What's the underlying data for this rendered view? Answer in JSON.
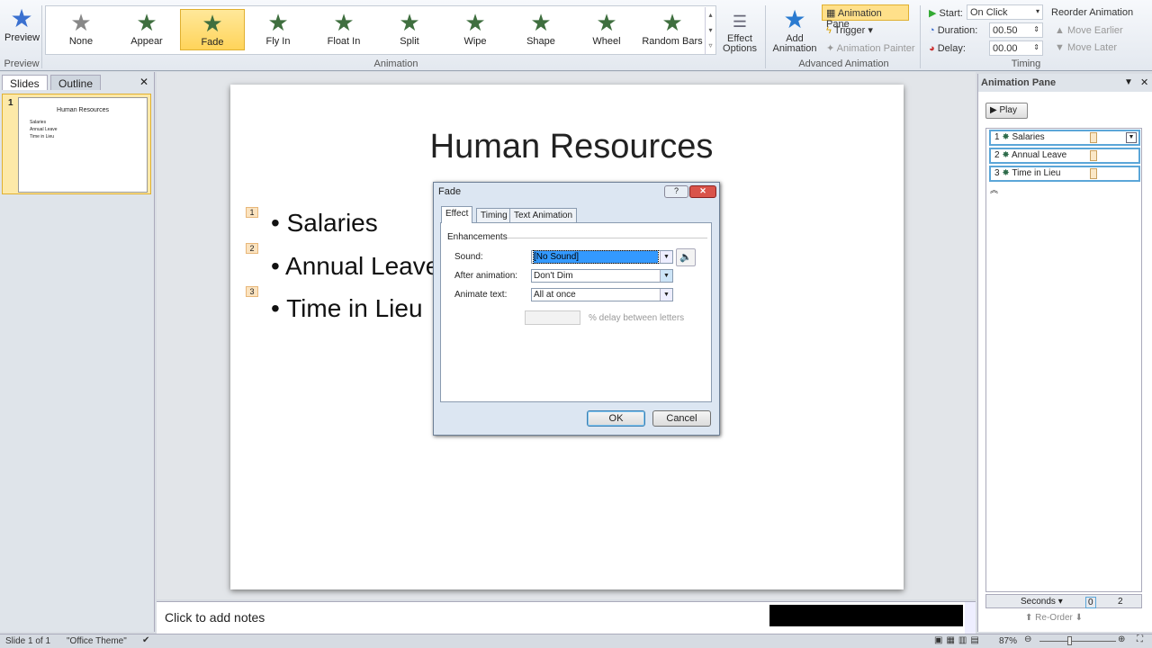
{
  "ribbon": {
    "preview": {
      "label": "Preview",
      "group": "Preview"
    },
    "animation_group": "Animation",
    "effects": [
      "None",
      "Appear",
      "Fade",
      "Fly In",
      "Float In",
      "Split",
      "Wipe",
      "Shape",
      "Wheel",
      "Random Bars"
    ],
    "selected_effect": "Fade",
    "effect_options": "Effect Options",
    "add_animation": "Add Animation",
    "animation_pane": "Animation Pane",
    "trigger": "Trigger",
    "animation_painter": "Animation Painter",
    "advanced_group": "Advanced Animation",
    "start_label": "Start:",
    "start_value": "On Click",
    "duration_label": "Duration:",
    "duration_value": "00.50",
    "delay_label": "Delay:",
    "delay_value": "00.00",
    "timing_group": "Timing",
    "reorder": "Reorder Animation",
    "move_earlier": "Move Earlier",
    "move_later": "Move Later"
  },
  "left_panel": {
    "tabs": [
      "Slides",
      "Outline"
    ],
    "slide_number": "1",
    "thumb_title": "Human Resources",
    "thumb_bullets": [
      "Salaries",
      "Annual Leave",
      "Time in Lieu"
    ]
  },
  "slide": {
    "title": "Human Resources",
    "bullets": [
      {
        "num": "1",
        "text": "Salaries"
      },
      {
        "num": "2",
        "text": "Annual Leave"
      },
      {
        "num": "3",
        "text": "Time in Lieu"
      }
    ]
  },
  "notes": {
    "placeholder": "Click to add notes"
  },
  "pane": {
    "title": "Animation Pane",
    "play": "Play",
    "items": [
      {
        "num": "1",
        "text": "Salaries"
      },
      {
        "num": "2",
        "text": "Annual Leave"
      },
      {
        "num": "3",
        "text": "Time in Lieu"
      }
    ],
    "seconds": "Seconds",
    "tick0": "0",
    "tick2": "2",
    "reorder": "Re-Order"
  },
  "dialog": {
    "title": "Fade",
    "tabs": [
      "Effect",
      "Timing",
      "Text Animation"
    ],
    "section": "Enhancements",
    "sound_label": "Sound:",
    "sound_value": "[No Sound]",
    "after_label": "After animation:",
    "after_value": "Don't Dim",
    "animate_label": "Animate text:",
    "animate_value": "All at once",
    "delay_text": "% delay between letters",
    "ok": "OK",
    "cancel": "Cancel"
  },
  "status": {
    "slide": "Slide 1 of 1",
    "theme": "\"Office Theme\"",
    "zoom": "87%"
  },
  "colors": {
    "accent": "#ffd45a",
    "star": "#3f6f3f",
    "selection": "#5ba6d8"
  }
}
